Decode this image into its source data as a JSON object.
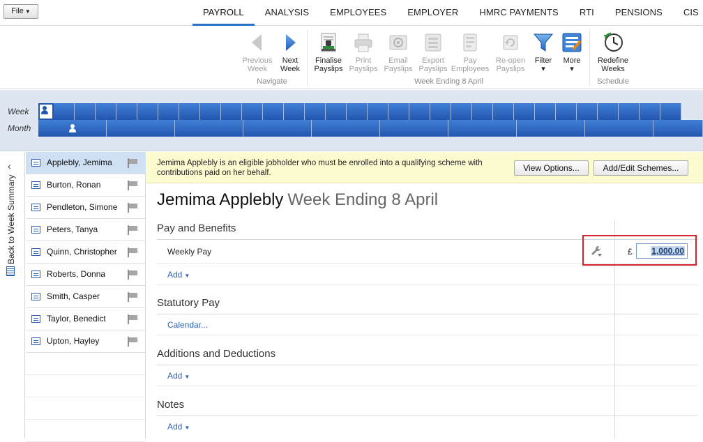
{
  "file_menu": {
    "label": "File"
  },
  "tabs": [
    {
      "label": "PAYROLL",
      "active": true
    },
    {
      "label": "ANALYSIS",
      "active": false
    },
    {
      "label": "EMPLOYEES",
      "active": false
    },
    {
      "label": "EMPLOYER",
      "active": false
    },
    {
      "label": "HMRC PAYMENTS",
      "active": false
    },
    {
      "label": "RTI",
      "active": false
    },
    {
      "label": "PENSIONS",
      "active": false
    },
    {
      "label": "CIS",
      "active": false
    }
  ],
  "ribbon": {
    "navigate": {
      "caption": "Navigate",
      "previous": {
        "line1": "Previous",
        "line2": "Week",
        "icon": "arrow-left-icon",
        "enabled": false
      },
      "next": {
        "line1": "Next",
        "line2": "Week",
        "icon": "arrow-right-icon",
        "enabled": true
      }
    },
    "week_ending": {
      "caption": "Week Ending 8 April",
      "buttons": [
        {
          "line1": "Finalise",
          "line2": "Payslips",
          "icon": "stamp-icon",
          "enabled": true
        },
        {
          "line1": "Print",
          "line2": "Payslips",
          "icon": "printer-icon",
          "enabled": false
        },
        {
          "line1": "Email",
          "line2": "Payslips",
          "icon": "email-icon",
          "enabled": false
        },
        {
          "line1": "Export",
          "line2": "Payslips",
          "icon": "export-icon",
          "enabled": false
        },
        {
          "line1": "Pay",
          "line2": "Employees",
          "icon": "pay-icon",
          "enabled": false
        },
        {
          "line1": "Re-open",
          "line2": "Payslips",
          "icon": "reopen-icon",
          "enabled": false
        },
        {
          "line1": "Filter",
          "line2": "▾",
          "icon": "filter-icon",
          "enabled": true
        },
        {
          "line1": "More",
          "line2": "▾",
          "icon": "more-icon",
          "enabled": true
        }
      ]
    },
    "schedule": {
      "caption": "Schedule",
      "redefine": {
        "line1": "Redefine",
        "line2": "Weeks",
        "icon": "clock-icon",
        "enabled": true
      }
    }
  },
  "period_strip": {
    "week_label": "Week",
    "month_label": "Month",
    "selected_week": 1,
    "visible_weeks": 31,
    "selected_month": 1
  },
  "back_bar": {
    "label": "Back to Week Summary",
    "icon": "chevron-left-icon"
  },
  "employees": [
    {
      "name": "Applebly, Jemima",
      "selected": true
    },
    {
      "name": "Burton, Ronan",
      "selected": false
    },
    {
      "name": "Pendleton, Simone",
      "selected": false
    },
    {
      "name": "Peters, Tanya",
      "selected": false
    },
    {
      "name": "Quinn, Christopher",
      "selected": false
    },
    {
      "name": "Roberts, Donna",
      "selected": false
    },
    {
      "name": "Smith, Casper",
      "selected": false
    },
    {
      "name": "Taylor, Benedict",
      "selected": false
    },
    {
      "name": "Upton, Hayley",
      "selected": false
    }
  ],
  "notice": {
    "text": "Jemima Applebly is an eligible jobholder who must be enrolled into a qualifying scheme with contributions paid on her behalf.",
    "view_options": "View Options...",
    "add_edit_schemes": "Add/Edit Schemes..."
  },
  "payslip": {
    "employee_name": "Jemima Applebly",
    "period": "Week Ending 8 April",
    "sections": {
      "pay_benefits": {
        "title": "Pay and Benefits",
        "row_label": "Weekly Pay",
        "currency": "£",
        "amount": "1,000.00",
        "add_label": "Add"
      },
      "statutory": {
        "title": "Statutory Pay",
        "calendar_label": "Calendar..."
      },
      "additions": {
        "title": "Additions and Deductions",
        "add_label": "Add"
      },
      "notes": {
        "title": "Notes",
        "add_label": "Add"
      }
    }
  },
  "colors": {
    "accent": "#2a72c8",
    "strip_blue": "#2356b0",
    "notice_bg": "#fdfbd0",
    "highlight_box": "#d2242a",
    "link": "#2a62b8"
  }
}
